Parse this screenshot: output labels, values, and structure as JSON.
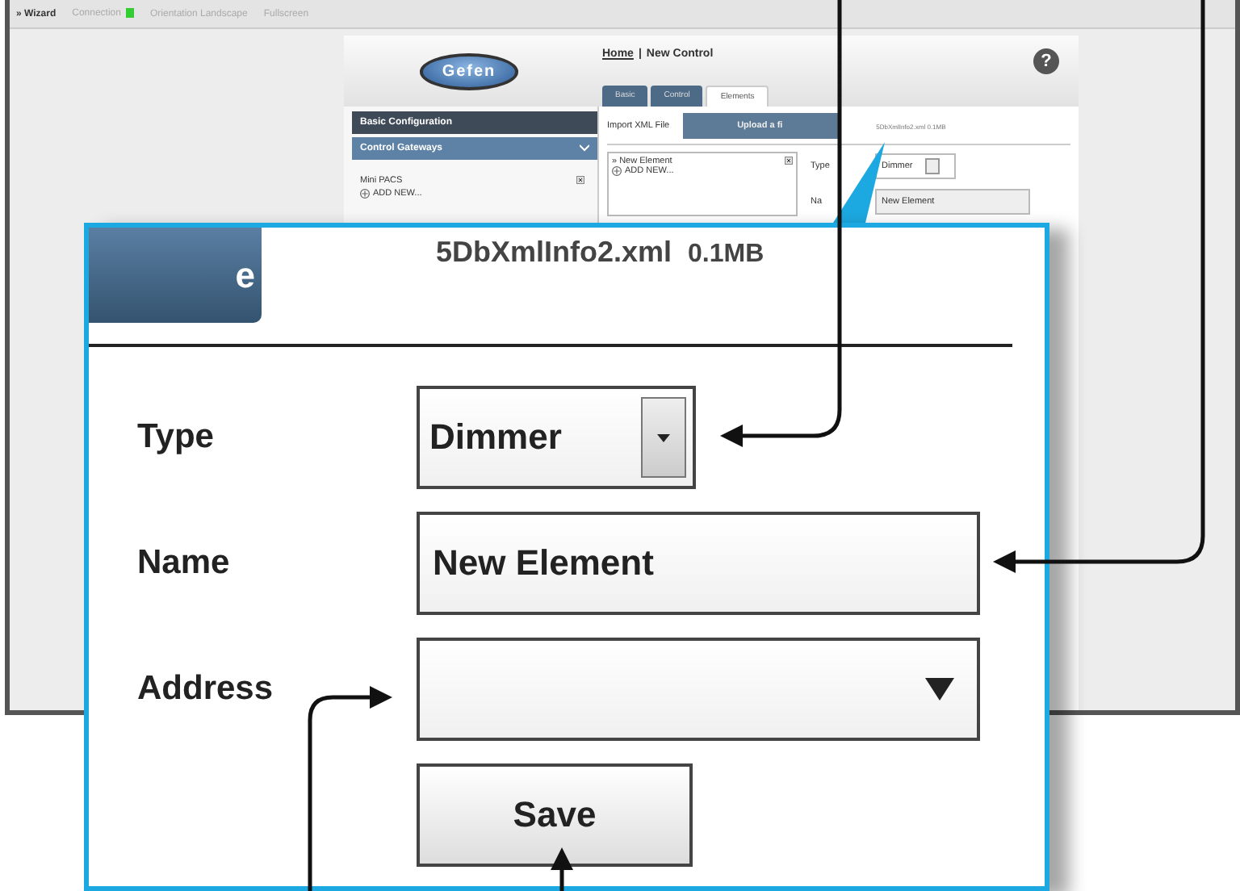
{
  "top_bar": {
    "items": [
      {
        "label": "» Wizard",
        "kind": "link"
      },
      {
        "label": "Connection",
        "kind": "status"
      },
      {
        "label": "Orientation Landscape",
        "kind": "link"
      },
      {
        "label": "Fullscreen",
        "kind": "link"
      }
    ]
  },
  "app": {
    "logo": "Gefen",
    "breadcrumb": {
      "home": "Home",
      "separator": "|",
      "current": "New Control"
    },
    "help": "?",
    "tabs": [
      {
        "label": "Basic",
        "selected": false
      },
      {
        "label": "Control",
        "selected": false
      },
      {
        "label": "Elements",
        "selected": true
      }
    ],
    "sidebar": {
      "sections": [
        {
          "label": "Basic Configuration",
          "expanded": false
        },
        {
          "label": "Control Gateways",
          "expanded": true
        }
      ],
      "gateways": [
        {
          "name": "Mini PACS"
        }
      ],
      "add_new": "ADD NEW..."
    },
    "import_label": "Import XML File",
    "upload_button": "Upload a fi",
    "file_info": "5DbXmlInfo2.xml  0.1MB",
    "elements": [
      {
        "label": "» New Element"
      }
    ],
    "elements_add": "ADD NEW...",
    "form": {
      "type_label": "Type",
      "type_value": "Dimmer",
      "name_label": "Na",
      "name_value": "New Element"
    }
  },
  "detail": {
    "button_fragment": "e",
    "file_name": "5DbXmlInfo2.xml",
    "file_size": "0.1MB",
    "fields": [
      {
        "kind": "dropdown",
        "label": "Type",
        "value": "Dimmer"
      },
      {
        "kind": "text",
        "label": "Name",
        "value": "New Element"
      },
      {
        "kind": "select",
        "label": "Address"
      }
    ],
    "save_button": "Save"
  }
}
